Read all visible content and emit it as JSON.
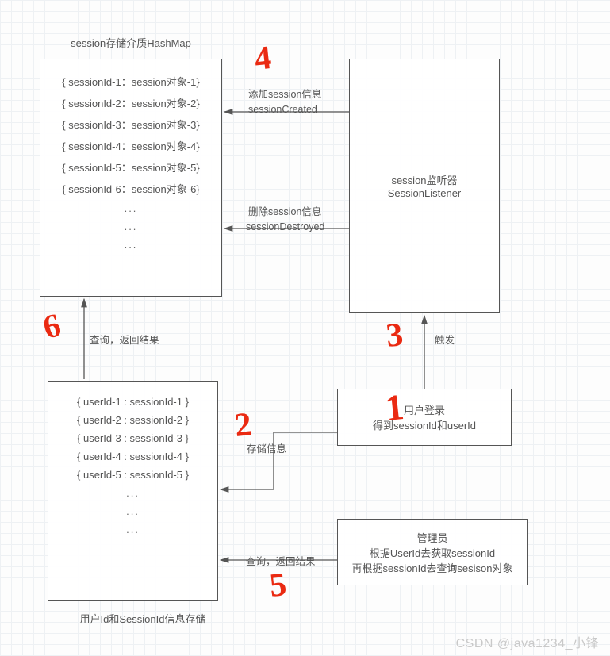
{
  "titles": {
    "hashmap": "session存储介质HashMap",
    "useridmap": "用户Id和SessionId信息存储"
  },
  "hashmap": {
    "rows": [
      "{ sessionId-1：session对象-1}",
      "{ sessionId-2：session对象-2}",
      "{ sessionId-3：session对象-3}",
      "{ sessionId-4：session对象-4}",
      "{ sessionId-5：session对象-5}",
      "{ sessionId-6：session对象-6}"
    ],
    "ellipsis": "..."
  },
  "useridmap": {
    "rows": [
      "{ userId-1 : sessionId-1 }",
      "{ userId-2 : sessionId-2 }",
      "{ userId-3 : sessionId-3 }",
      "{ userId-4 : sessionId-4 }",
      "{ userId-5 : sessionId-5 }"
    ],
    "ellipsis": "..."
  },
  "listenerBox": {
    "line1": "session监听器",
    "line2": "SessionListener"
  },
  "loginBox": {
    "line1": "用户登录",
    "line2": "得到sessionId和userId"
  },
  "adminBox": {
    "line1": "管理员",
    "line2": "根据UserId去获取sessionId",
    "line3": "再根据sessionId去查询sesison对象"
  },
  "edges": {
    "addSession": "添加session信息",
    "sessionCreated": "sessionCreated",
    "delSession": "删除session信息",
    "sessionDestroyed": "sessionDestroyed",
    "trigger": "触发",
    "store": "存储信息",
    "queryResult1": "查询，返回结果",
    "queryResult2": "查询，返回结果"
  },
  "annotations": {
    "n1": "1",
    "n2": "2",
    "n3": "3",
    "n4": "4",
    "n5": "5",
    "n6": "6"
  },
  "watermark": "CSDN @java1234_小锋"
}
